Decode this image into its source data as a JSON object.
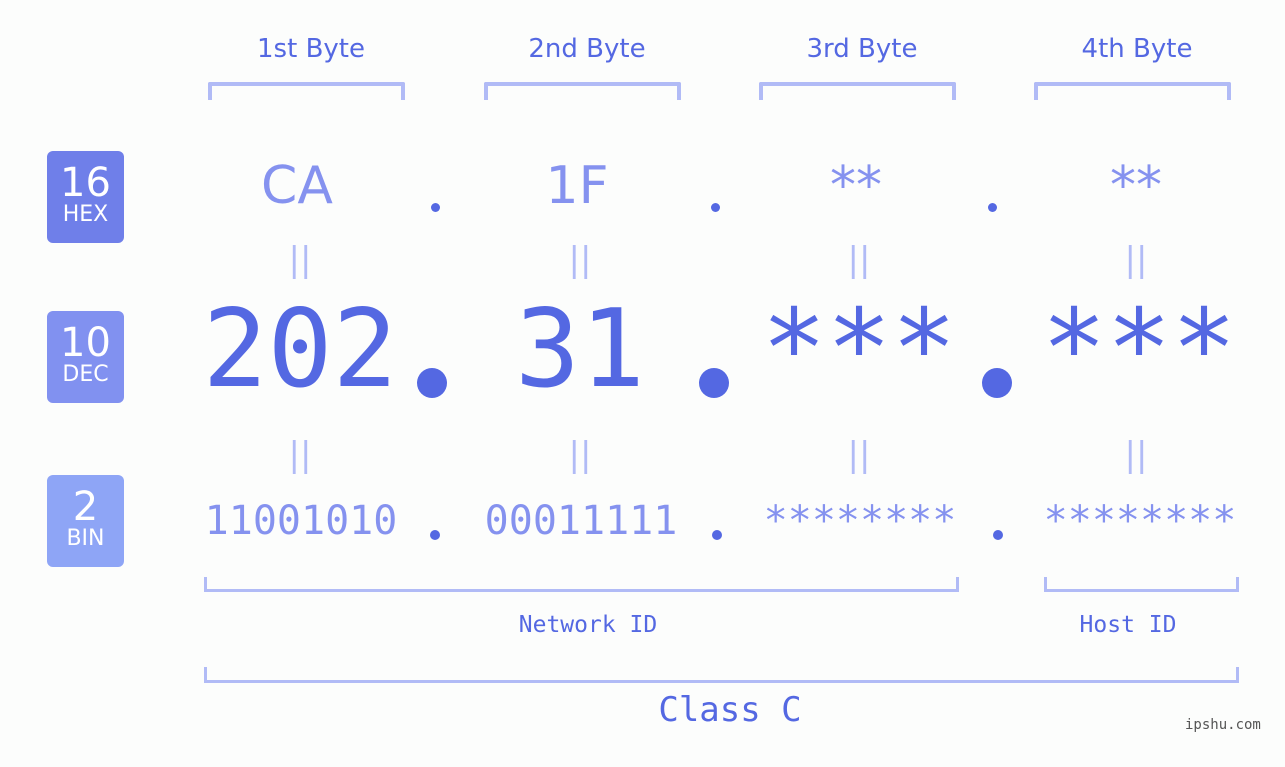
{
  "byte_headers": [
    "1st Byte",
    "2nd Byte",
    "3rd Byte",
    "4th Byte"
  ],
  "rows": {
    "hex": {
      "badge_number": "16",
      "badge_label": "HEX",
      "badge_color": "#6f7fe9",
      "values": [
        "CA",
        "1F",
        "**",
        "**"
      ]
    },
    "dec": {
      "badge_number": "10",
      "badge_label": "DEC",
      "badge_color": "#8191f0",
      "values": [
        "202",
        "31",
        "***",
        "***"
      ]
    },
    "bin": {
      "badge_number": "2",
      "badge_label": "BIN",
      "badge_color": "#8ea5f6",
      "values": [
        "11001010",
        "00011111",
        "********",
        "********"
      ]
    }
  },
  "equals_symbol": "||",
  "separator": ".",
  "network_id_label": "Network ID",
  "host_id_label": "Host ID",
  "class_label": "Class C",
  "watermark": "ipshu.com",
  "colors": {
    "primary": "#5468e2",
    "secondary": "#8592ef",
    "light": "#b1bbf6"
  }
}
